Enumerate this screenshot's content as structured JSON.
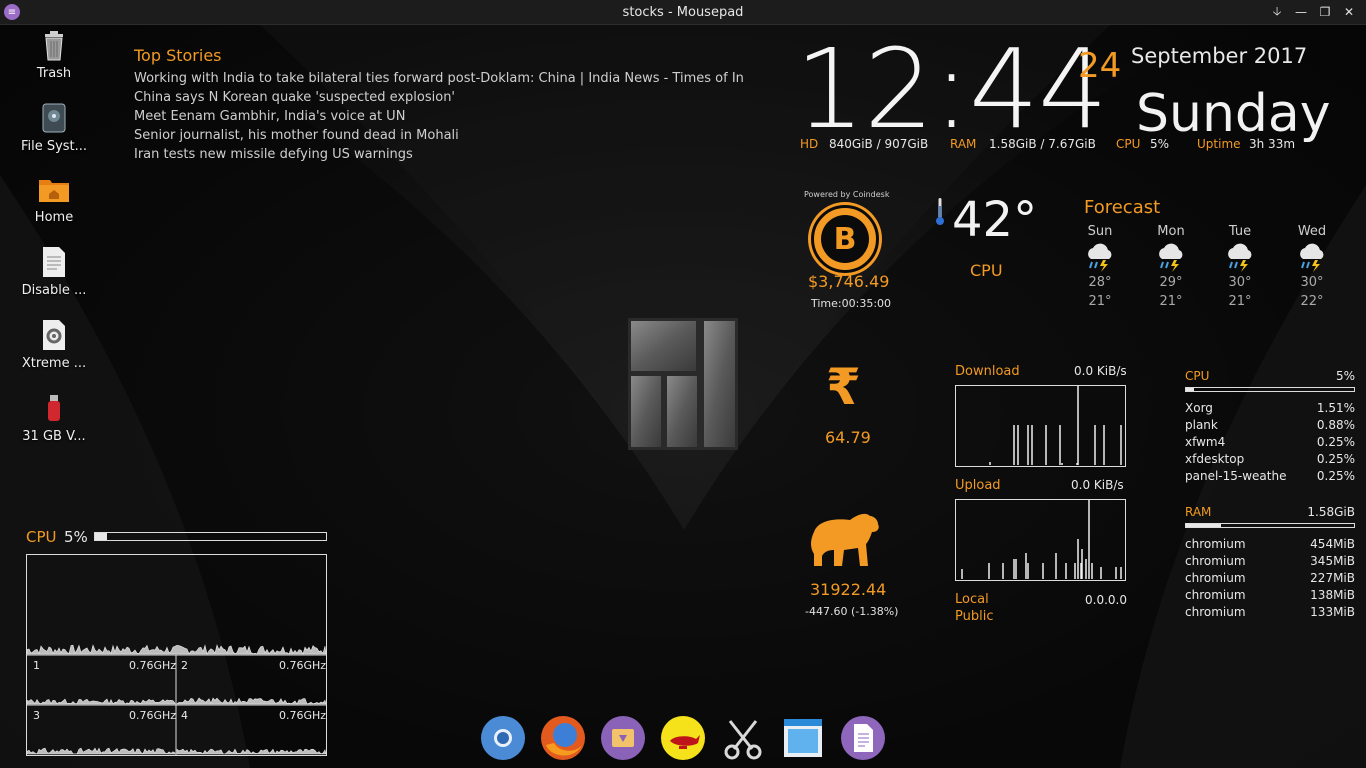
{
  "window": {
    "title": "stocks - Mousepad"
  },
  "desktop_icons": [
    {
      "label": "Trash",
      "icon": "trash-icon"
    },
    {
      "label": "File Syst...",
      "icon": "drive-icon"
    },
    {
      "label": "Home",
      "icon": "folder-home-icon"
    },
    {
      "label": "Disable ...",
      "icon": "text-file-icon"
    },
    {
      "label": "Xtreme ...",
      "icon": "settings-file-icon"
    },
    {
      "label": "31 GB V...",
      "icon": "usb-drive-icon"
    }
  ],
  "stories": {
    "header": "Top Stories",
    "items": [
      "Working with India to take bilateral ties forward post-Doklam: China | India News - Times of In",
      "China says N Korean quake 'suspected explosion'",
      "Meet Eenam Gambhir, India's voice at UN",
      "Senior journalist, his mother found dead in Mohali",
      "Iran tests new missile defying US warnings"
    ]
  },
  "clock": {
    "time": "12:44",
    "day": "24",
    "month_year": "September 2017",
    "weekday": "Sunday"
  },
  "system": {
    "hd_label": "HD",
    "hd_value": "840GiB / 907GiB",
    "ram_label": "RAM",
    "ram_value": "1.58GiB / 7.67GiB",
    "cpu_label": "CPU",
    "cpu_value": "5%",
    "uptime_label": "Uptime",
    "uptime_value": "3h 33m"
  },
  "bitcoin": {
    "powered": "Powered by Coindesk",
    "symbol": "B",
    "price": "$3,746.49",
    "time": "Time:00:35:00"
  },
  "temperature": {
    "value": "42°",
    "label": "CPU"
  },
  "forecast": {
    "header": "Forecast",
    "days": [
      {
        "day": "Sun",
        "hi": "28°",
        "lo": "21°"
      },
      {
        "day": "Mon",
        "hi": "29°",
        "lo": "21°"
      },
      {
        "day": "Tue",
        "hi": "30°",
        "lo": "21°"
      },
      {
        "day": "Wed",
        "hi": "30°",
        "lo": "22°"
      }
    ]
  },
  "rupee": {
    "symbol": "₹",
    "value": "64.79"
  },
  "market": {
    "value": "31922.44",
    "change": "-447.60 (-1.38%)"
  },
  "network": {
    "download_label": "Download",
    "download_rate": "0.0 KiB/s",
    "upload_label": "Upload",
    "upload_rate": "0.0 KiB/s",
    "local_label": "Local",
    "public_label": "Public",
    "ip": "0.0.0.0"
  },
  "cpu_procs": {
    "header": "CPU",
    "total": "5%",
    "usage_fraction": 0.05,
    "rows": [
      {
        "name": "Xorg",
        "value": "1.51%"
      },
      {
        "name": "plank",
        "value": "0.88%"
      },
      {
        "name": "xfwm4",
        "value": "0.25%"
      },
      {
        "name": "xfdesktop",
        "value": "0.25%"
      },
      {
        "name": "panel-15-weathe",
        "value": "0.25%"
      }
    ]
  },
  "ram_procs": {
    "header": "RAM",
    "total": "1.58GiB",
    "usage_fraction": 0.21,
    "rows": [
      {
        "name": "chromium",
        "value": "454MiB"
      },
      {
        "name": "chromium",
        "value": "345MiB"
      },
      {
        "name": "chromium",
        "value": "227MiB"
      },
      {
        "name": "chromium",
        "value": "138MiB"
      },
      {
        "name": "chromium",
        "value": "133MiB"
      }
    ]
  },
  "cpu_panel": {
    "label": "CPU",
    "value": "5%",
    "usage_fraction": 0.05,
    "cores": [
      {
        "num": "1",
        "freq": "0.76GHz"
      },
      {
        "num": "2",
        "freq": "0.76GHz"
      },
      {
        "num": "3",
        "freq": "0.76GHz"
      },
      {
        "num": "4",
        "freq": "0.76GHz"
      }
    ]
  },
  "dock": {
    "items": [
      "chromium-icon",
      "firefox-icon",
      "archive-manager-icon",
      "genie-lamp-icon",
      "scissors-icon",
      "window-manager-icon",
      "text-editor-icon"
    ]
  },
  "colors": {
    "accent": "#f29a23",
    "text": "#e8e8e8",
    "background": "#0b0b0b"
  }
}
